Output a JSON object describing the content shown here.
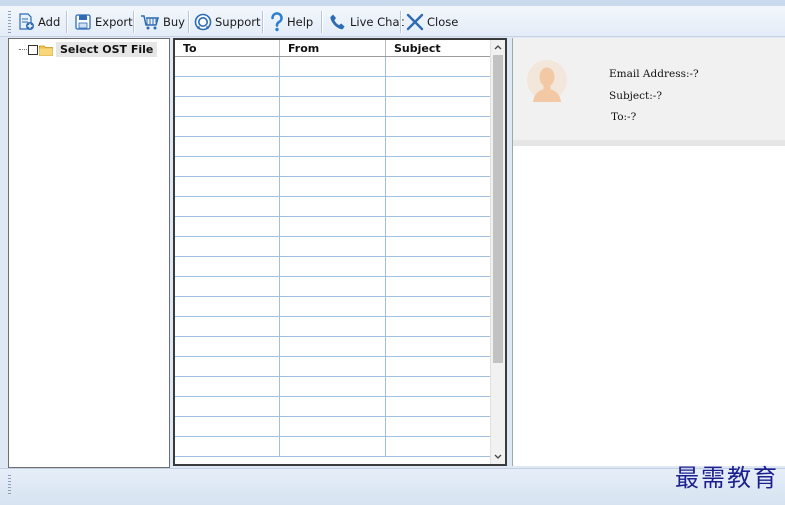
{
  "toolbar": {
    "add": "Add",
    "export": "Export",
    "buy": "Buy",
    "support": "Support",
    "help": "Help",
    "live_chat": "Live Chat",
    "close": "Close"
  },
  "tree": {
    "root_label": "Select OST File"
  },
  "grid": {
    "columns": [
      "To",
      "From",
      "Subject"
    ],
    "row_count": 20
  },
  "preview": {
    "email_address": "Email Address:-?",
    "subject": "Subject:-?",
    "to": "To:-?"
  },
  "watermark": "最需教育"
}
